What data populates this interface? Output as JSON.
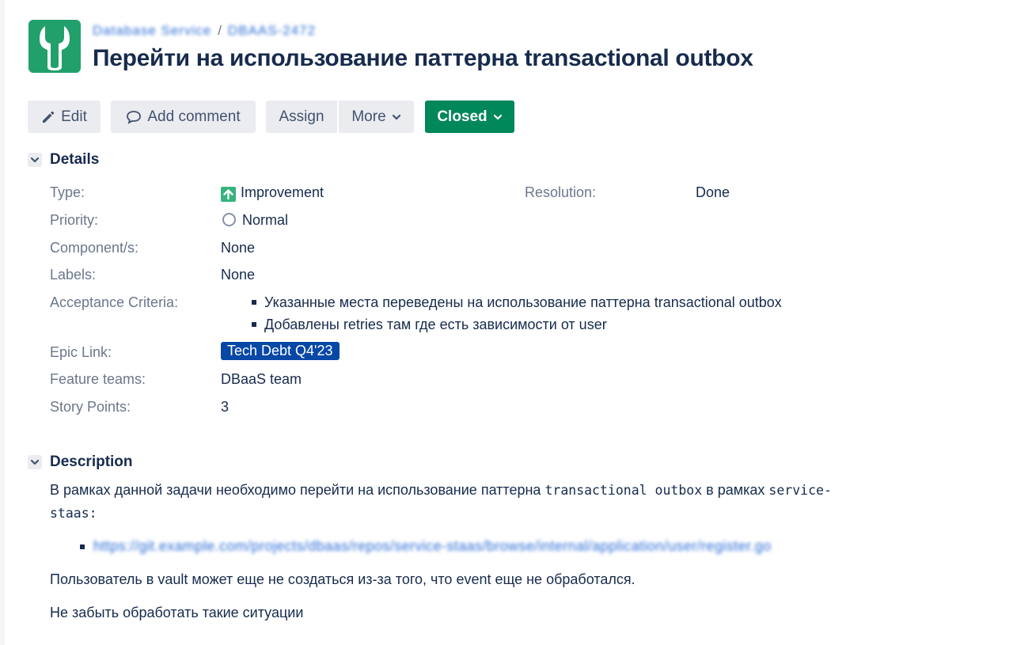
{
  "breadcrumbs": {
    "project": "Database Service",
    "separator": "/",
    "issue_key": "DBAAS-2472"
  },
  "issue": {
    "title": "Перейти на использование паттерна transactional outbox"
  },
  "toolbar": {
    "edit_label": "Edit",
    "add_comment_label": "Add comment",
    "assign_label": "Assign",
    "more_label": "More",
    "status_label": "Closed"
  },
  "details": {
    "heading": "Details",
    "type_label": "Type:",
    "type_value": "Improvement",
    "resolution_label": "Resolution:",
    "resolution_value": "Done",
    "priority_label": "Priority:",
    "priority_value": "Normal",
    "components_label": "Component/s:",
    "components_value": "None",
    "labels_label": "Labels:",
    "labels_value": "None",
    "acceptance_label": "Acceptance Criteria:",
    "acceptance_items": [
      "Указанные места переведены на использование паттерна transactional outbox",
      "Добавлены retries там где есть зависимости от user"
    ],
    "epic_link_label": "Epic Link:",
    "epic_link_value": "Tech Debt Q4'23",
    "feature_teams_label": "Feature teams:",
    "feature_teams_value": "DBaaS team",
    "story_points_label": "Story Points:",
    "story_points_value": "3"
  },
  "description": {
    "heading": "Description",
    "intro_text": "В рамках данной задачи необходимо перейти на использование паттерна",
    "intro_code": "transactional outbox",
    "intro_mid": "в рамках",
    "intro_code2_line1": "service-",
    "intro_code2_line2": "staas",
    "intro_colon": ":",
    "link_text": "https://git.example.com/projects/dbaas/repos/service-staas/browse/internal/application/user/register.go",
    "paragraph1": "Пользователь в vault может еще не создаться из-за того, что event еще не обработался.",
    "paragraph2": "Не забыть обработать такие ситуации"
  },
  "colors": {
    "project_avatar": "#22a06b",
    "status_button": "#00875a",
    "epic_lozenge": "#0747a6",
    "link": "#0052cc",
    "text": "#172b4d",
    "label": "#6b778c"
  },
  "icons": {
    "project": "wrench-icon",
    "edit": "pencil-icon",
    "comment": "comment-icon",
    "more": "chevron-down-icon",
    "status": "chevron-down-icon",
    "type": "improvement-arrow-icon",
    "priority": "normal-priority-icon"
  }
}
